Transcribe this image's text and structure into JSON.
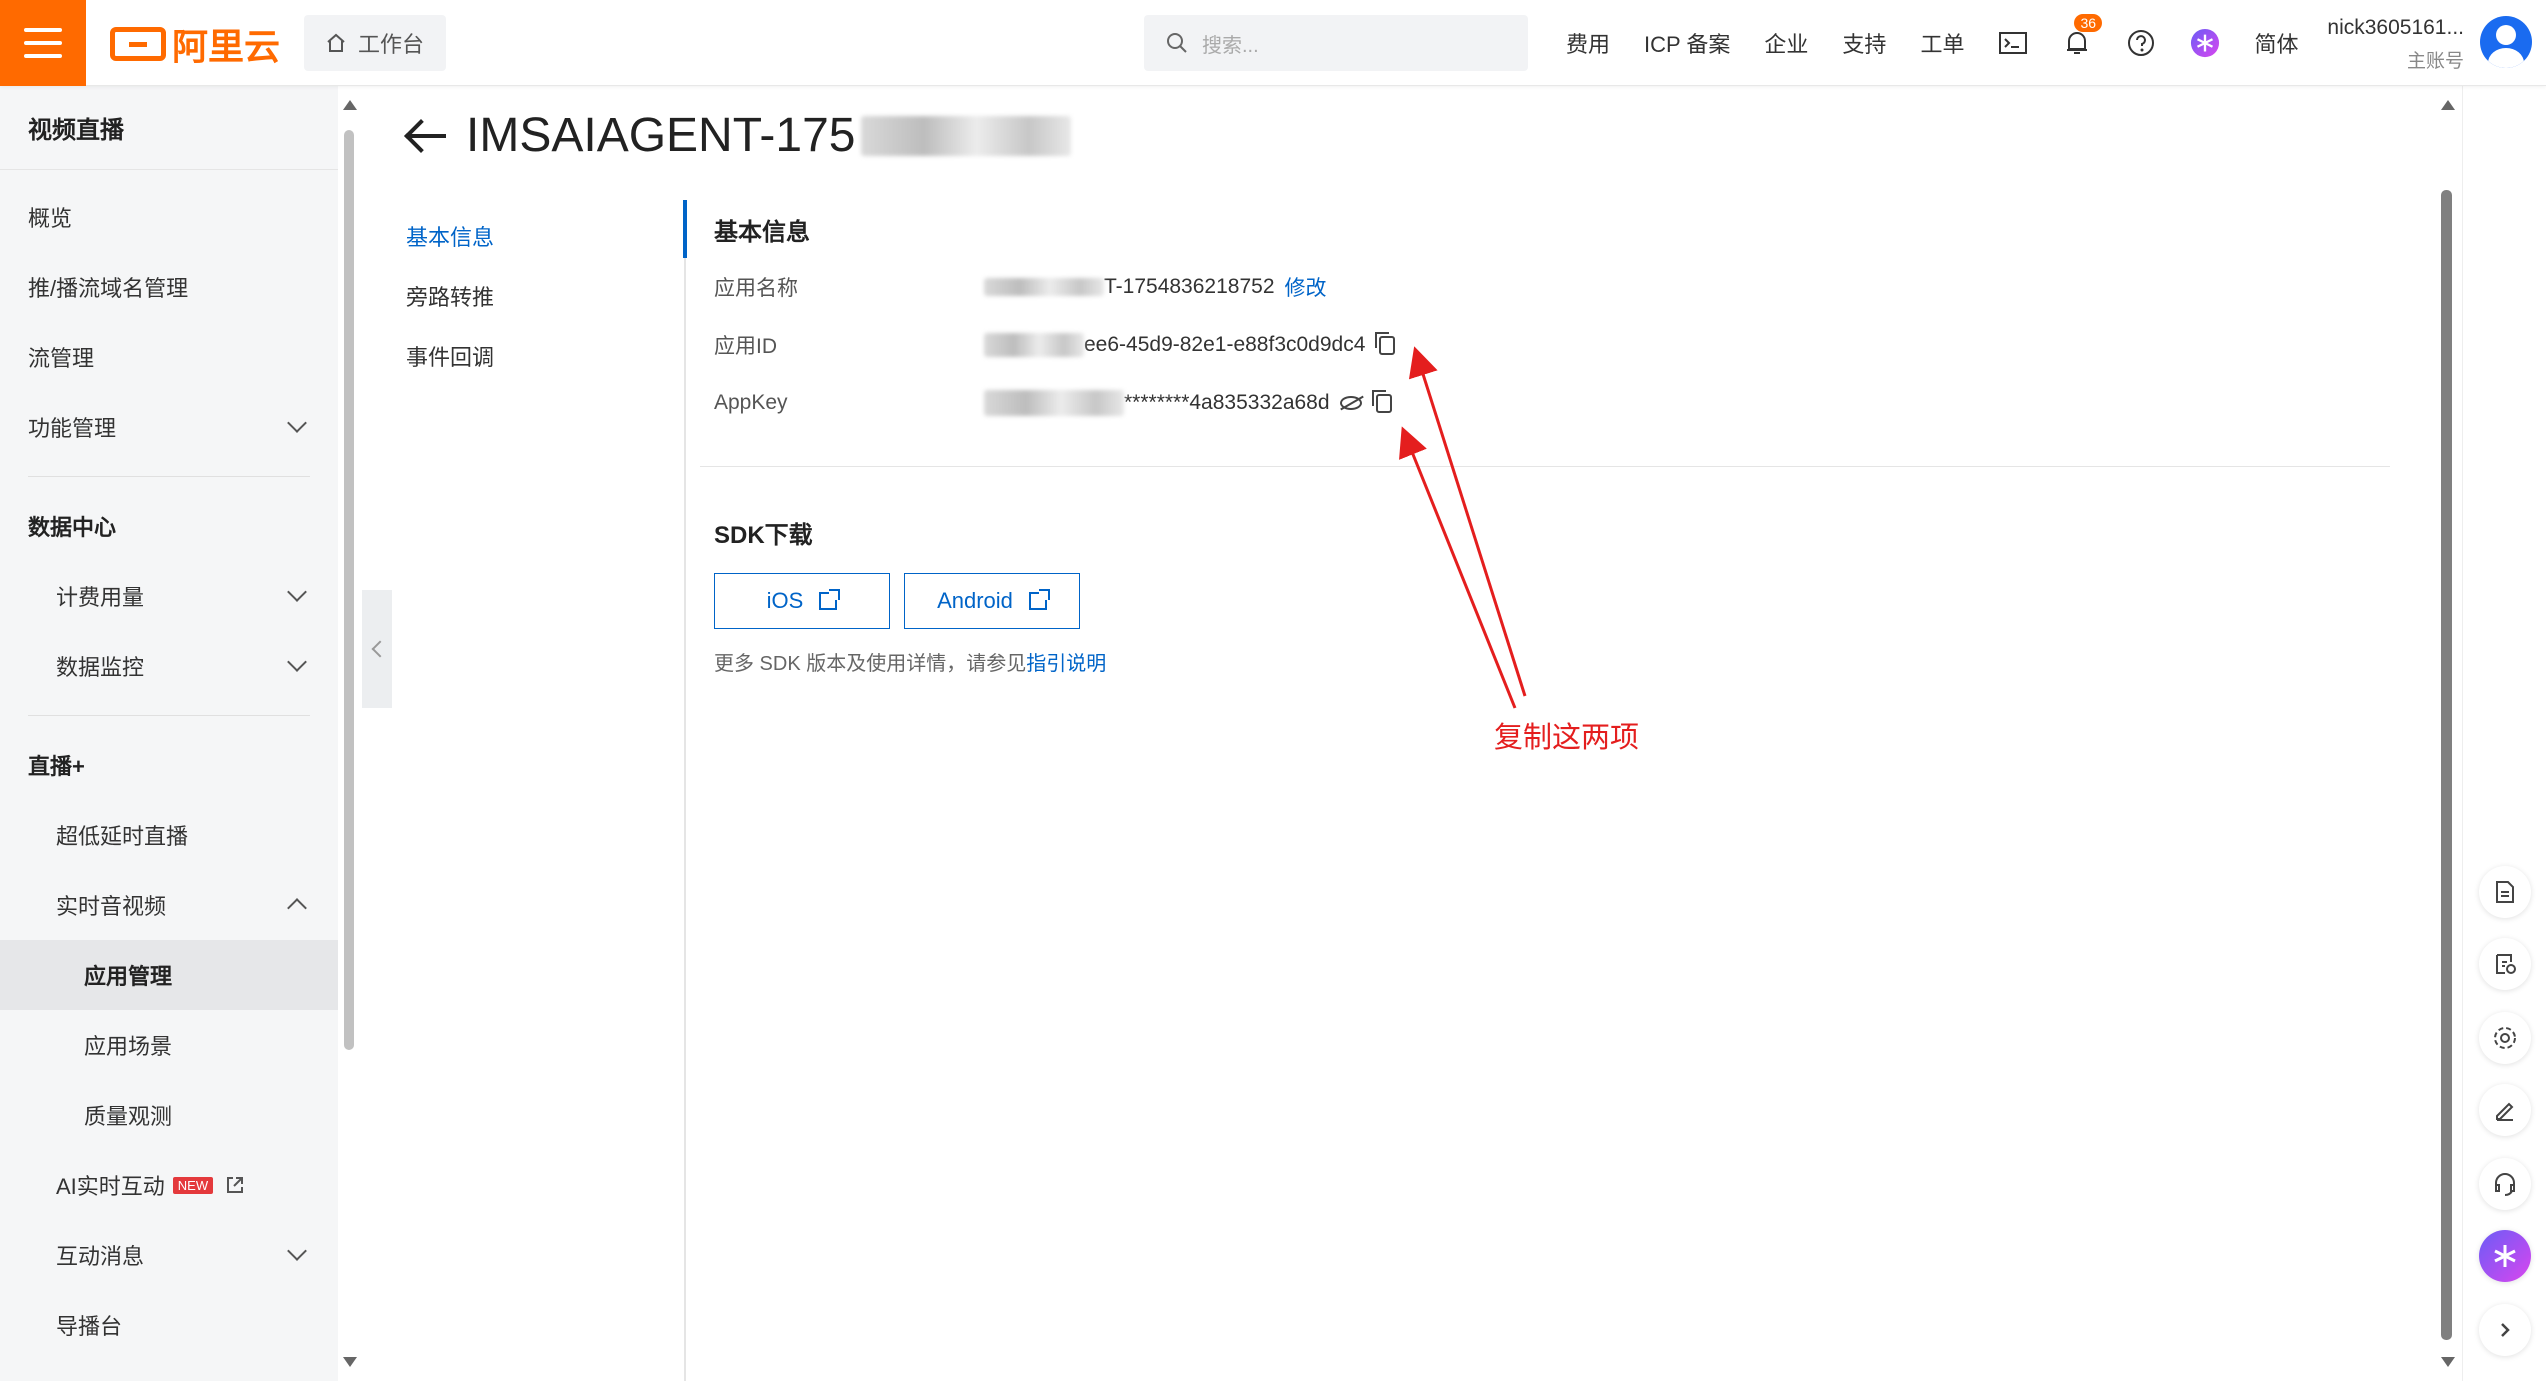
{
  "topbar": {
    "logo_text": "阿里云",
    "workbench": "工作台",
    "search_placeholder": "搜索...",
    "nav": [
      "费用",
      "ICP 备案",
      "企业",
      "支持",
      "工单"
    ],
    "notification_count": "36",
    "language": "简体",
    "user_name": "nick3605161...",
    "user_role": "主账号"
  },
  "sidebar": {
    "title": "视频直播",
    "items": [
      {
        "label": "概览"
      },
      {
        "label": "推/播流域名管理"
      },
      {
        "label": "流管理"
      },
      {
        "label": "功能管理"
      }
    ],
    "data_center": "数据中心",
    "data_items": [
      {
        "label": "计费用量"
      },
      {
        "label": "数据监控"
      }
    ],
    "live_plus": "直播+",
    "live_items": [
      {
        "label": "超低延时直播"
      },
      {
        "label": "实时音视频"
      }
    ],
    "rtc_items": [
      {
        "label": "应用管理"
      },
      {
        "label": "应用场景"
      },
      {
        "label": "质量观测"
      }
    ],
    "more_items": [
      {
        "label": "AI实时互动"
      },
      {
        "label": "互动消息"
      },
      {
        "label": "导播台"
      }
    ],
    "new_badge": "NEW"
  },
  "page": {
    "title": "IMSAIAGENT-175"
  },
  "subnav": [
    "基本信息",
    "旁路转推",
    "事件回调"
  ],
  "basic": {
    "section_title": "基本信息",
    "name_label": "应用名称",
    "name_value": "T-1754836218752",
    "edit": "修改",
    "id_label": "应用ID",
    "id_value": "ee6-45d9-82e1-e88f3c0d9dc4",
    "key_label": "AppKey",
    "key_value": "********4a835332a68d"
  },
  "sdk": {
    "section_title": "SDK下载",
    "ios": "iOS",
    "android": "Android",
    "note_prefix": "更多 SDK 版本及使用详情，请参见",
    "note_link": "指引说明"
  },
  "annotation": "复制这两项",
  "colors": {
    "brand": "#ff6a00",
    "link": "#0064c8",
    "annotation": "#e41e1e"
  }
}
